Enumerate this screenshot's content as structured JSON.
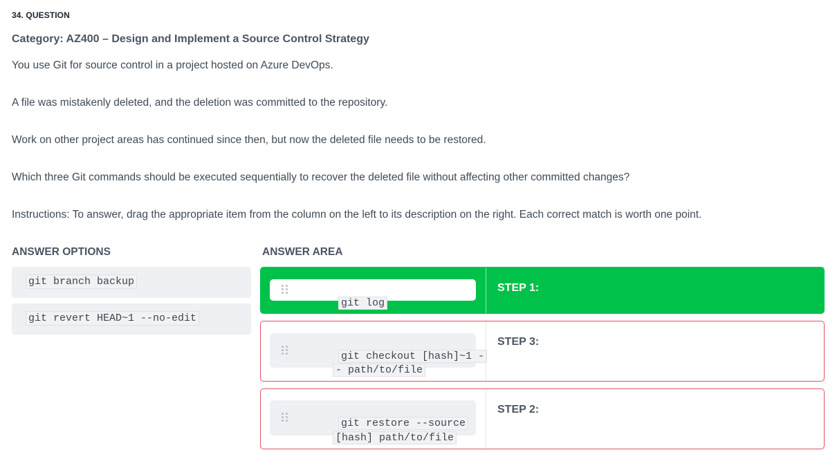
{
  "question": {
    "number": "34. QUESTION",
    "category": "Category: AZ400 – Design and Implement a Source Control Strategy",
    "paragraphs": [
      "You use Git for source control in a project hosted on Azure DevOps.",
      "A file was mistakenly deleted, and the deletion was committed to the repository.",
      "Work on other project areas has continued since then, but now the deleted file needs to be restored.",
      "Which three Git commands should be executed sequentially to recover the deleted file without affecting other committed changes?",
      "Instructions: To answer, drag the appropriate item from the column on the left to its description on the right. Each correct match is worth one point."
    ]
  },
  "answer_options": {
    "title": "ANSWER OPTIONS",
    "items": [
      "git branch backup",
      "git revert HEAD~1 --no-edit"
    ]
  },
  "answer_area": {
    "title": "ANSWER AREA",
    "rows": [
      {
        "step": "STEP 1:",
        "line1": "git log",
        "line2": "",
        "status": "correct"
      },
      {
        "step": "STEP 3:",
        "line1": "git checkout [hash]~1 -",
        "line2": "- path/to/file",
        "status": "incorrect"
      },
      {
        "step": "STEP 2:",
        "line1": "git restore --source",
        "line2": "[hash] path/to/file",
        "status": "incorrect"
      }
    ]
  },
  "colors": {
    "correct": "#00c24a",
    "incorrect_border": "#e05260",
    "chip_background": "#eef0f3"
  },
  "icons": {
    "drag_handle": "grip-dots-icon"
  }
}
